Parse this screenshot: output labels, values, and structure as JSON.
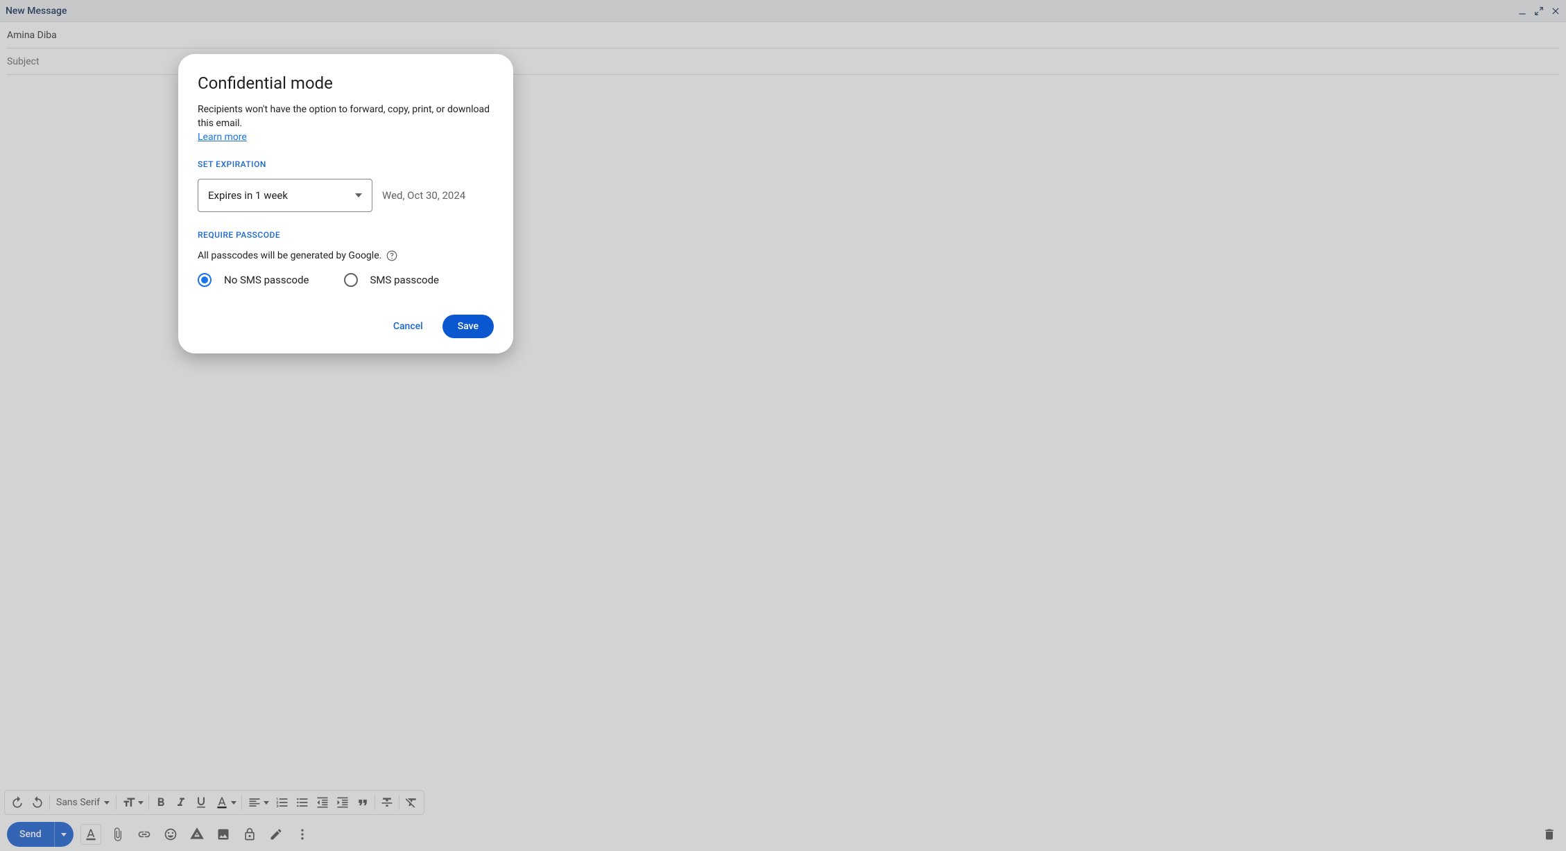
{
  "header": {
    "title": "New Message"
  },
  "recipient": "Amina Diba",
  "subject_placeholder": "Subject",
  "format": {
    "font": "Sans Serif"
  },
  "send_label": "Send",
  "dialog": {
    "title": "Confidential mode",
    "description": "Recipients won't have the option to forward, copy, print, or download this email.",
    "learn_more": "Learn more",
    "set_expiration_label": "SET EXPIRATION",
    "expiration_value": "Expires in 1 week",
    "expiration_date": "Wed, Oct 30, 2024",
    "require_passcode_label": "REQUIRE PASSCODE",
    "passcode_note": "All passcodes will be generated by Google.",
    "radio_no_sms": "No SMS passcode",
    "radio_sms": "SMS passcode",
    "cancel": "Cancel",
    "save": "Save"
  }
}
